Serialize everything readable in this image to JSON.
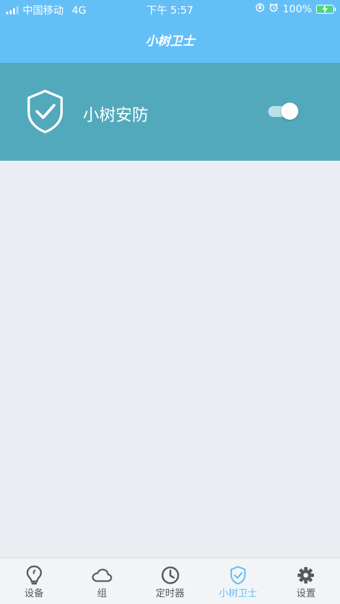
{
  "status_bar": {
    "carrier": "中国移动",
    "network": "4G",
    "time": "下午 5:57",
    "battery": "100%",
    "icons": [
      "signal-icon",
      "orientation-lock-icon",
      "alarm-icon",
      "battery-charging-icon"
    ]
  },
  "nav": {
    "title": "小树卫士"
  },
  "banner": {
    "icon": "shield-check-icon",
    "label": "小树安防",
    "toggle_on": true
  },
  "tabs": [
    {
      "label": "设备",
      "icon": "lightbulb-icon",
      "active": false
    },
    {
      "label": "组",
      "icon": "cloud-icon",
      "active": false
    },
    {
      "label": "定时器",
      "icon": "clock-icon",
      "active": false
    },
    {
      "label": "小树卫士",
      "icon": "shield-check-icon",
      "active": true
    },
    {
      "label": "设置",
      "icon": "gear-icon",
      "active": false
    }
  ],
  "colors": {
    "header": "#64bff7",
    "banner": "#53a9bc",
    "background": "#ebedf2",
    "tab_active": "#64bff7",
    "tab_inactive": "#555a62"
  }
}
